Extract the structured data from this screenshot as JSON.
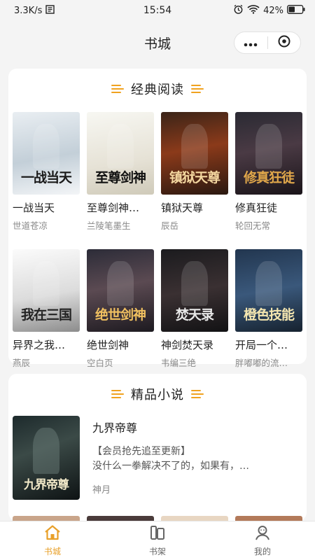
{
  "status": {
    "speed": "3.3K/s",
    "time": "15:54",
    "battery": "42%"
  },
  "nav": {
    "title": "书城"
  },
  "sections": {
    "classic": {
      "title": "经典阅读",
      "books": [
        {
          "title": "一战当天",
          "author": "世道苍凉",
          "cover_text": "一战当天",
          "cover_bg": "linear-gradient(170deg,#e9eef2 0%,#c3cfd8 55%,#f3f5f7 100%)",
          "cover_color": "#1a1a1a"
        },
        {
          "title": "至尊剑神…",
          "author": "兰陵笔墨生",
          "cover_text": "至尊剑神",
          "cover_bg": "linear-gradient(170deg,#f7f7f2 0%,#e6e2d6 60%,#cfcab9 100%)",
          "cover_color": "#111"
        },
        {
          "title": "镇狱天尊",
          "author": "辰岳",
          "cover_text": "镇狱天尊",
          "cover_bg": "linear-gradient(170deg,#3a2418 0%,#8b3a1a 45%,#2a1810 100%)",
          "cover_color": "#f4d7a0"
        },
        {
          "title": "修真狂徒",
          "author": "轮回无常",
          "cover_text": "修真狂徒",
          "cover_bg": "linear-gradient(170deg,#2a2a33 0%,#4a3a44 45%,#1a1419 100%)",
          "cover_color": "#e0a74a"
        },
        {
          "title": "异界之我…",
          "author": "燕辰",
          "cover_text": "我在三国",
          "cover_bg": "linear-gradient(170deg,#fbfbfb 0%,#dcdcdc 55%,#8c8c8c 100%)",
          "cover_color": "#222"
        },
        {
          "title": "绝世剑神",
          "author": "空白页",
          "cover_text": "绝世剑神",
          "cover_bg": "linear-gradient(170deg,#2c2c38 0%,#5b4a52 45%,#1d1a20 100%)",
          "cover_color": "#f0c060"
        },
        {
          "title": "神剑焚天录",
          "author": "韦编三绝",
          "cover_text": "焚天录",
          "cover_bg": "linear-gradient(170deg,#1b1b1e 0%,#3a3032 50%,#121214 100%)",
          "cover_color": "#e8e8e8"
        },
        {
          "title": "开局一个…",
          "author": "胖嘟嘟的流…",
          "cover_text": "橙色技能",
          "cover_bg": "linear-gradient(170deg,#22364f 0%,#3a587b 50%,#16222f 100%)",
          "cover_color": "#f4e6b0"
        }
      ]
    },
    "premium": {
      "title": "精品小说",
      "feature": {
        "title": "九界帝尊",
        "desc_line1": "【会员抢先追至更新】",
        "desc_line2": "没什么一拳解决不了的，如果有，…",
        "author": "神月",
        "cover_text": "九界帝尊"
      }
    }
  },
  "peek_colors": [
    "#c9a58a",
    "#4a3b3a",
    "#e8d6c2",
    "#b37a5a"
  ],
  "tabs": [
    {
      "label": "书城",
      "active": true
    },
    {
      "label": "书架",
      "active": false
    },
    {
      "label": "我的",
      "active": false
    }
  ],
  "colors": {
    "accent": "#f0a21f",
    "active_tab": "#e8a02a"
  }
}
